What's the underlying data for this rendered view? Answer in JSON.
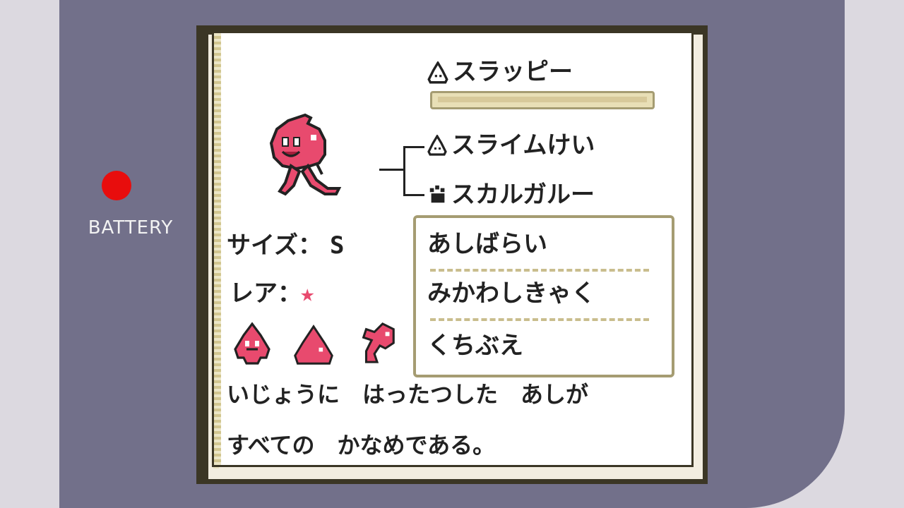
{
  "battery_label": "BATTERY",
  "monster": {
    "name": "スラッピー",
    "family_icon": "slime-icon",
    "family_label": "スライムけい",
    "parent_icon": "paw-icon",
    "parent_label": "スカルガルー",
    "size_label": "サイズ：",
    "size_value": "S",
    "rarity_label": "レア：",
    "rarity_value": "★",
    "description_line1": "いじょうに　はったつした　あしが",
    "description_line2": "すべての　かなめである。"
  },
  "skills": [
    "あしばらい",
    "みかわしきゃく",
    "くちぶえ"
  ],
  "colors": {
    "monster": "#e84a6e",
    "console": "#72708a",
    "battery_led": "#e80d0d"
  }
}
